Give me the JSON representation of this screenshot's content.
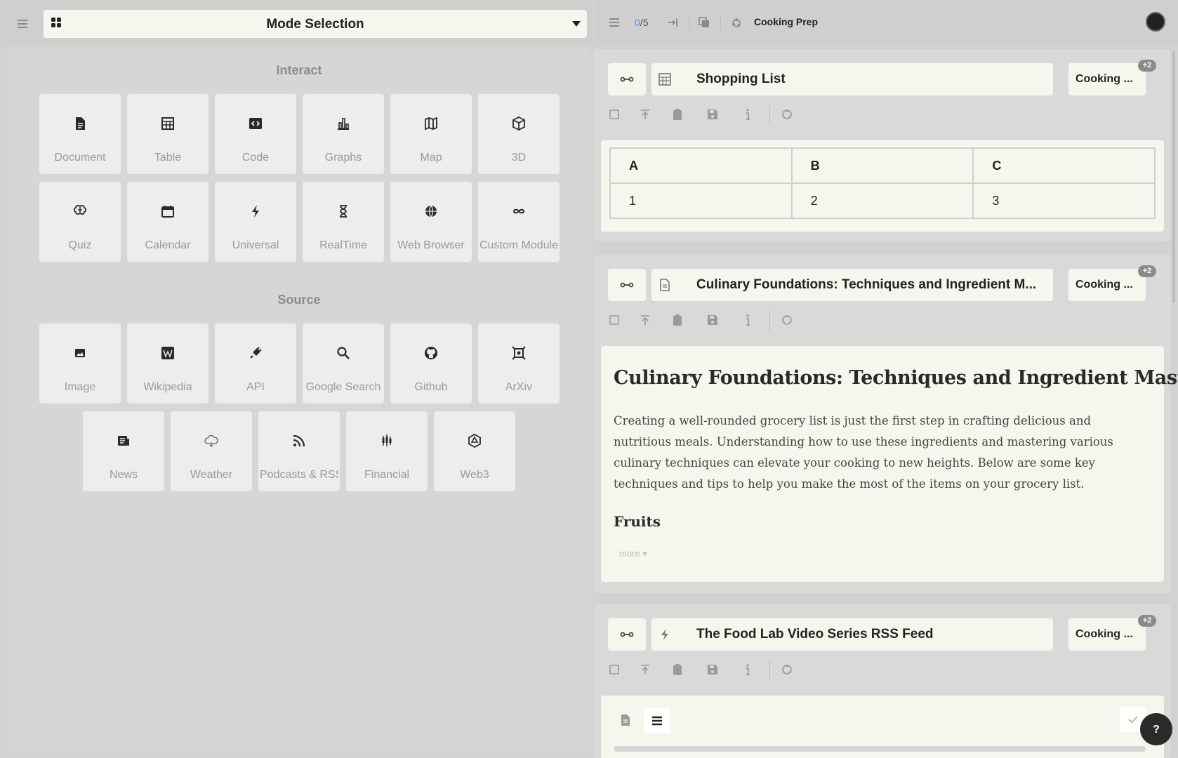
{
  "header": {
    "mode_title": "Mode Selection",
    "page_count": {
      "current": "0",
      "separator": "/",
      "total": "5"
    },
    "workspace_title": "Cooking Prep"
  },
  "interact": {
    "title": "Interact",
    "tiles": [
      {
        "label": "Document",
        "icon": "document-icon"
      },
      {
        "label": "Table",
        "icon": "table-icon"
      },
      {
        "label": "Code",
        "icon": "code-icon"
      },
      {
        "label": "Graphs",
        "icon": "bar-chart-icon"
      },
      {
        "label": "Map",
        "icon": "map-icon"
      },
      {
        "label": "3D",
        "icon": "cube-icon"
      },
      {
        "label": "Quiz",
        "icon": "brain-icon"
      },
      {
        "label": "Calendar",
        "icon": "calendar-icon"
      },
      {
        "label": "Universal",
        "icon": "bolt-icon"
      },
      {
        "label": "RealTime",
        "icon": "hourglass-icon"
      },
      {
        "label": "Web Browser",
        "icon": "globe-icon"
      },
      {
        "label": "Custom Module",
        "icon": "infinity-icon"
      }
    ]
  },
  "source": {
    "title": "Source",
    "tiles": [
      {
        "label": "Image",
        "icon": "image-icon"
      },
      {
        "label": "Wikipedia",
        "icon": "wikipedia-icon"
      },
      {
        "label": "API",
        "icon": "plug-icon"
      },
      {
        "label": "Google Search",
        "icon": "search-icon"
      },
      {
        "label": "Github",
        "icon": "github-icon"
      },
      {
        "label": "ArXiv",
        "icon": "arxiv-icon"
      },
      {
        "label": "News",
        "icon": "newspaper-icon"
      },
      {
        "label": "Weather",
        "icon": "cloud-icon"
      },
      {
        "label": "Podcasts & RSS",
        "icon": "rss-icon"
      },
      {
        "label": "Financial",
        "icon": "candlestick-icon"
      },
      {
        "label": "Web3",
        "icon": "web3-icon"
      }
    ]
  },
  "cards": [
    {
      "title": "Shopping List",
      "tag": "Cooking ...",
      "badge": "+2",
      "table": {
        "headers": [
          "A",
          "B",
          "C"
        ],
        "rows": [
          [
            "1",
            "2",
            "3"
          ]
        ]
      }
    },
    {
      "title": "Culinary Foundations: Techniques and Ingredient M...",
      "tag": "Cooking ...",
      "badge": "+2",
      "doc": {
        "heading": "Culinary Foundations: Techniques and Ingredient Mastery",
        "paragraph": "Creating a well-rounded grocery list is just the first step in crafting delicious and nutritious meals. Understanding how to use these ingredients and mastering various culinary techniques can elevate your cooking to new heights. Below are some key techniques and tips to help you make the most of the items on your grocery list.",
        "subheading": "Fruits",
        "more": "more ▾"
      }
    },
    {
      "title": "The Food Lab Video Series RSS Feed",
      "tag": "Cooking ...",
      "badge": "+2"
    }
  ],
  "help": {
    "label": "?"
  },
  "colors": {
    "accent": "#4a90d9",
    "panel": "#f7f6ee",
    "background": "#d2d2d2",
    "tile": "#ededeb"
  }
}
